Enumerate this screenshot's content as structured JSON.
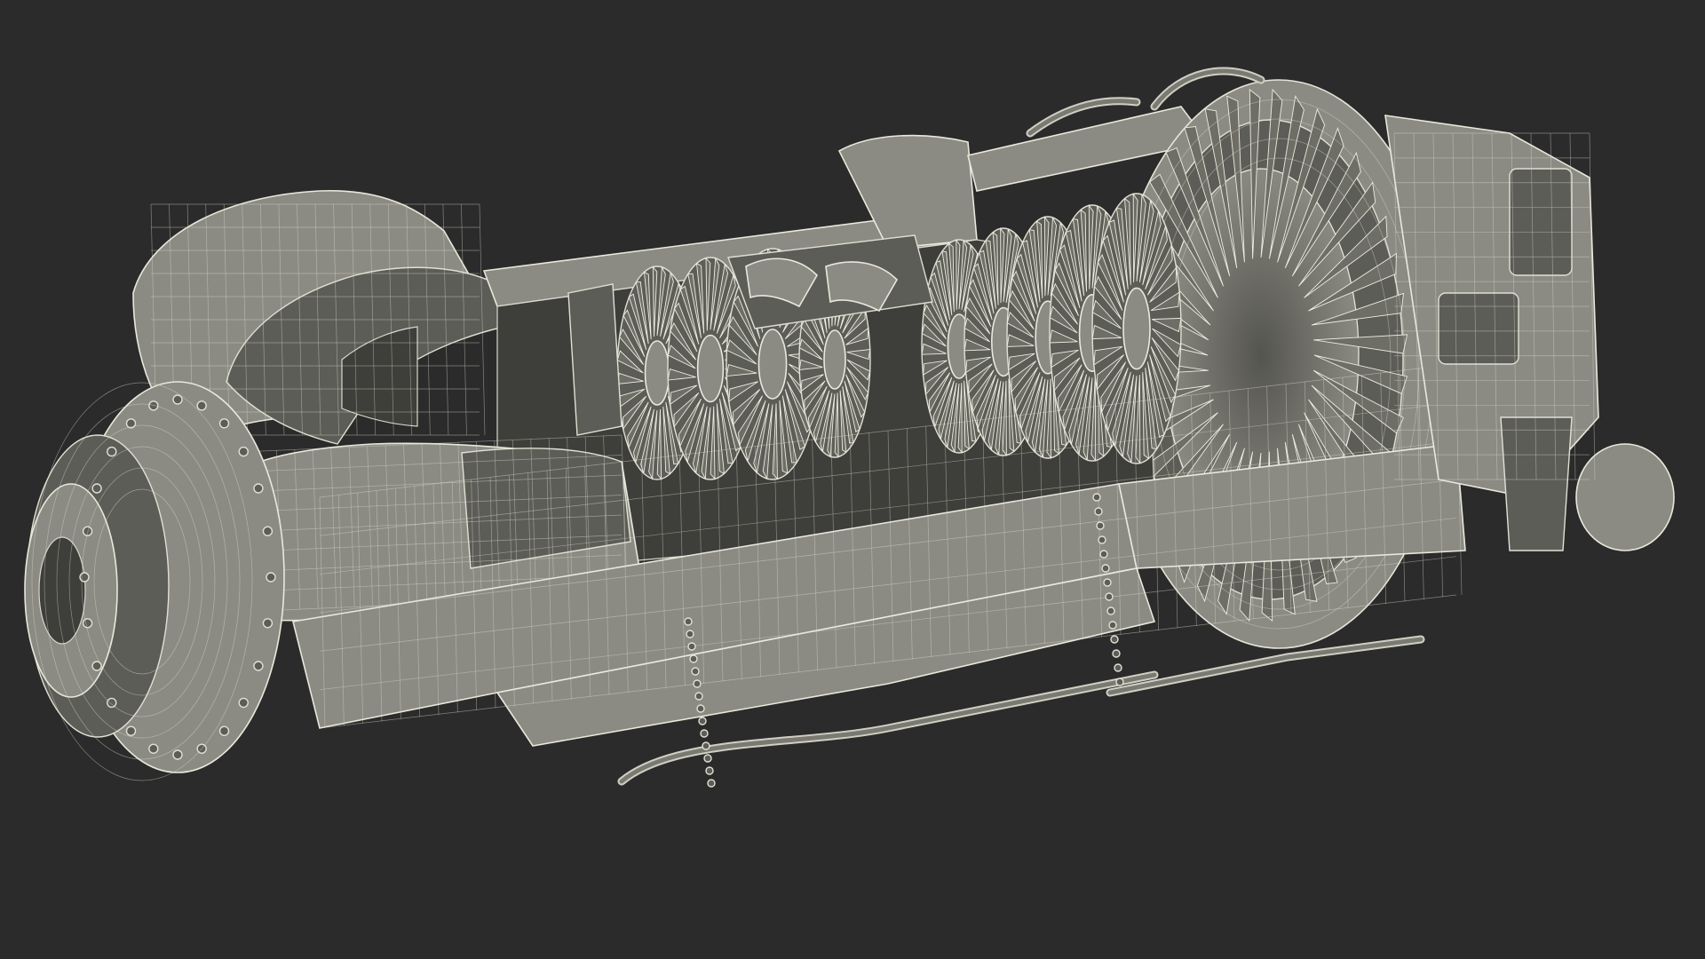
{
  "scene": {
    "subject": "gas-turbine-engine-cutaway-wireframe",
    "colors": {
      "background": "#2b2b2b",
      "mesh_fill": "#8b8b83",
      "wire": "#e8e8dc"
    }
  }
}
